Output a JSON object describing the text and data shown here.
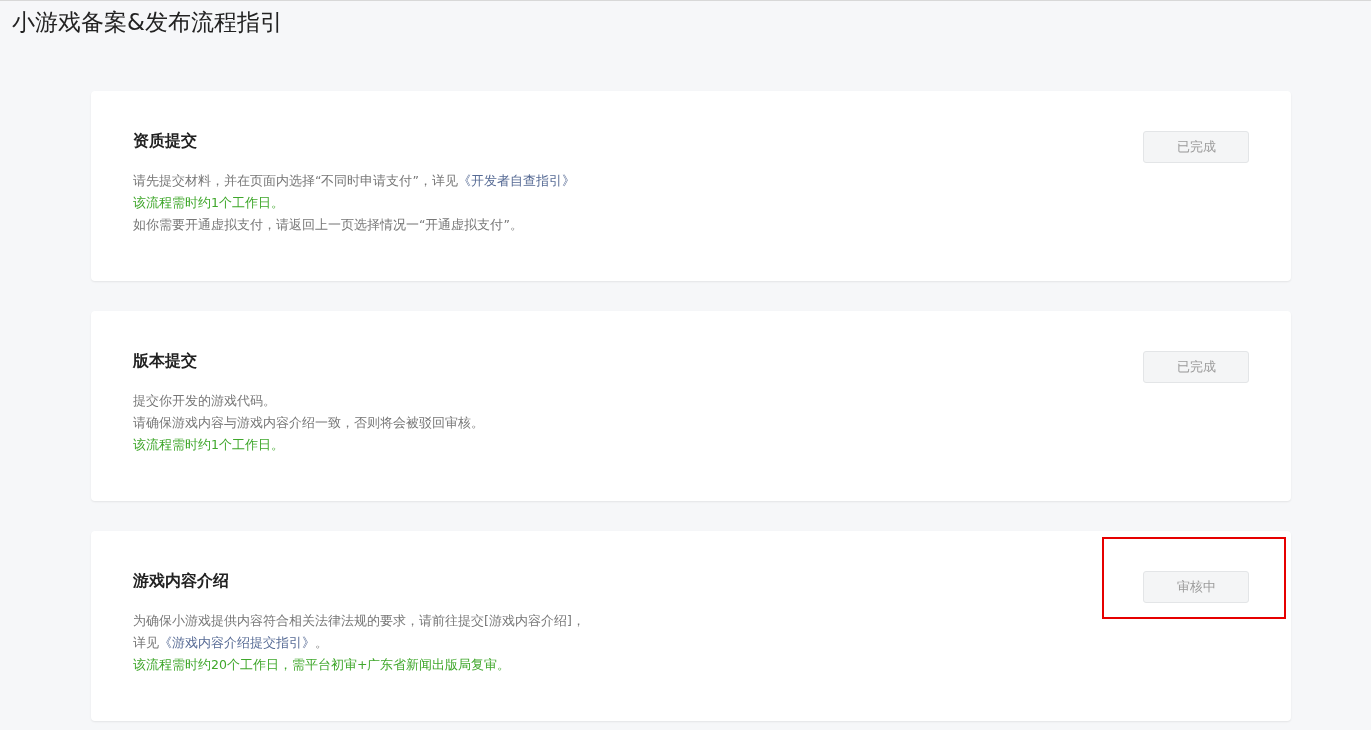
{
  "page_title": "小游戏备案&发布流程指引",
  "steps": [
    {
      "title": "资质提交",
      "button": {
        "label": "已完成",
        "disabled": true
      },
      "highlighted": false,
      "lines": [
        {
          "kind": "plain",
          "parts": [
            {
              "kind": "text",
              "text": "请先提交材料，并在页面内选择“不同时申请支付”，详见"
            },
            {
              "kind": "link",
              "text": "《开发者自查指引》"
            }
          ]
        },
        {
          "kind": "note",
          "parts": [
            {
              "kind": "text",
              "text": "该流程需时约1个工作日。"
            }
          ]
        },
        {
          "kind": "plain",
          "parts": [
            {
              "kind": "text",
              "text": "如你需要开通虚拟支付，请返回上一页选择情况一“开通虚拟支付”。"
            }
          ]
        }
      ]
    },
    {
      "title": "版本提交",
      "button": {
        "label": "已完成",
        "disabled": true
      },
      "highlighted": false,
      "lines": [
        {
          "kind": "plain",
          "parts": [
            {
              "kind": "text",
              "text": "提交你开发的游戏代码。"
            }
          ]
        },
        {
          "kind": "plain",
          "parts": [
            {
              "kind": "text",
              "text": "请确保游戏内容与游戏内容介绍一致，否则将会被驳回审核。"
            }
          ]
        },
        {
          "kind": "note",
          "parts": [
            {
              "kind": "text",
              "text": "该流程需时约1个工作日。"
            }
          ]
        }
      ]
    },
    {
      "title": "游戏内容介绍",
      "button": {
        "label": "审核中",
        "disabled": true
      },
      "highlighted": true,
      "lines": [
        {
          "kind": "plain",
          "parts": [
            {
              "kind": "text",
              "text": "为确保小游戏提供内容符合相关法律法规的要求，请前往提交[游戏内容介绍]，"
            }
          ]
        },
        {
          "kind": "plain",
          "parts": [
            {
              "kind": "text",
              "text": "详见"
            },
            {
              "kind": "link",
              "text": "《游戏内容介绍提交指引》"
            },
            {
              "kind": "text",
              "text": "。"
            }
          ]
        },
        {
          "kind": "note",
          "parts": [
            {
              "kind": "text",
              "text": "该流程需时约20个工作日，需平台初审+广东省新闻出版局复审。"
            }
          ]
        }
      ]
    }
  ]
}
